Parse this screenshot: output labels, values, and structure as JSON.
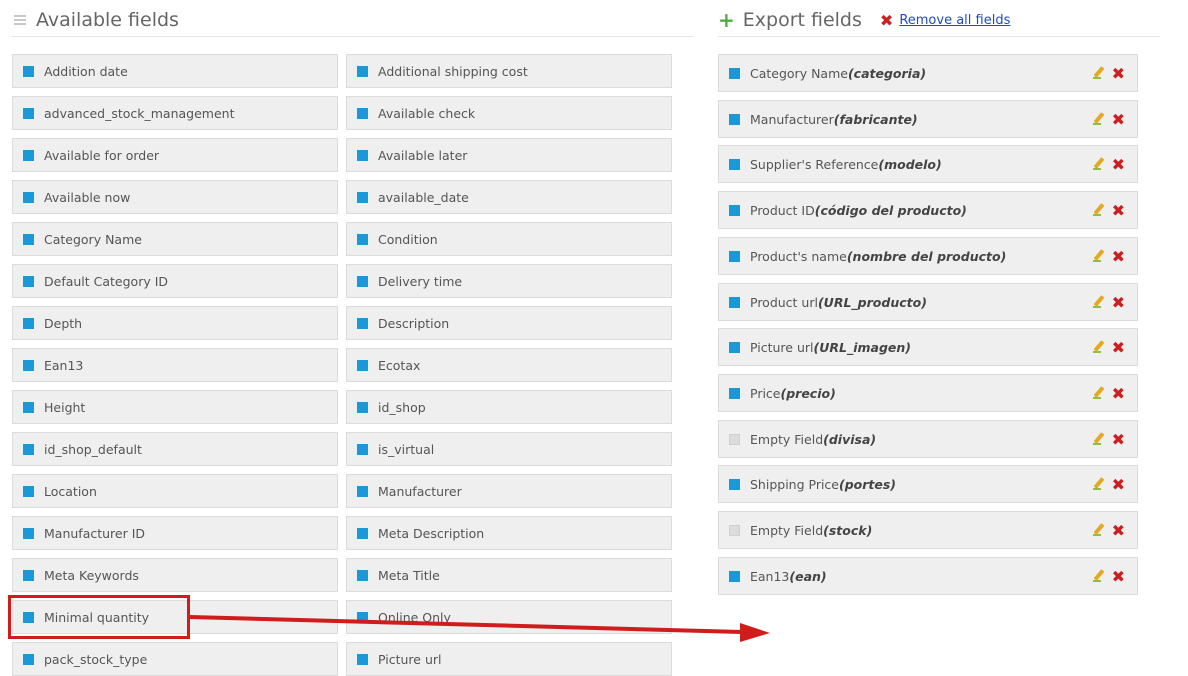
{
  "available": {
    "title": "Available fields",
    "fields": [
      {
        "label": "Addition date",
        "col": 0
      },
      {
        "label": "Additional shipping cost",
        "col": 1
      },
      {
        "label": "advanced_stock_management",
        "col": 0
      },
      {
        "label": "Available check",
        "col": 1
      },
      {
        "label": "Available for order",
        "col": 0
      },
      {
        "label": "Available later",
        "col": 1
      },
      {
        "label": "Available now",
        "col": 0
      },
      {
        "label": "available_date",
        "col": 1
      },
      {
        "label": "Category Name",
        "col": 0
      },
      {
        "label": "Condition",
        "col": 1
      },
      {
        "label": "Default Category ID",
        "col": 0
      },
      {
        "label": "Delivery time",
        "col": 1
      },
      {
        "label": "Depth",
        "col": 0
      },
      {
        "label": "Description",
        "col": 1
      },
      {
        "label": "Ean13",
        "col": 0
      },
      {
        "label": "Ecotax",
        "col": 1
      },
      {
        "label": "Height",
        "col": 0
      },
      {
        "label": "id_shop",
        "col": 1
      },
      {
        "label": "id_shop_default",
        "col": 0
      },
      {
        "label": "is_virtual",
        "col": 1
      },
      {
        "label": "Location",
        "col": 0
      },
      {
        "label": "Manufacturer",
        "col": 1
      },
      {
        "label": "Manufacturer ID",
        "col": 0
      },
      {
        "label": "Meta Description",
        "col": 1
      },
      {
        "label": "Meta Keywords",
        "col": 0
      },
      {
        "label": "Meta Title",
        "col": 1
      },
      {
        "label": "Minimal quantity",
        "col": 0
      },
      {
        "label": "Online Only",
        "col": 1
      },
      {
        "label": "pack_stock_type",
        "col": 0
      },
      {
        "label": "Picture url",
        "col": 1
      }
    ]
  },
  "export": {
    "title": "Export fields",
    "remove_all_label": "Remove all fields",
    "fields": [
      {
        "name": "Category Name",
        "alias": "(categoria)",
        "enabled": true
      },
      {
        "name": "Manufacturer",
        "alias": "(fabricante)",
        "enabled": true
      },
      {
        "name": "Supplier's Reference",
        "alias": "(modelo)",
        "enabled": true
      },
      {
        "name": "Product ID",
        "alias": "(código del producto)",
        "enabled": true
      },
      {
        "name": "Product's name",
        "alias": "(nombre del producto)",
        "enabled": true
      },
      {
        "name": "Product url",
        "alias": "(URL_producto)",
        "enabled": true
      },
      {
        "name": "Picture url",
        "alias": "(URL_imagen)",
        "enabled": true
      },
      {
        "name": "Price",
        "alias": "(precio)",
        "enabled": true
      },
      {
        "name": "Empty Field",
        "alias": "(divisa)",
        "enabled": false
      },
      {
        "name": "Shipping Price",
        "alias": "(portes)",
        "enabled": true
      },
      {
        "name": "Empty Field",
        "alias": "(stock)",
        "enabled": false
      },
      {
        "name": "Ean13",
        "alias": "(ean)",
        "enabled": true
      }
    ]
  },
  "colors": {
    "accent_blue": "#1a99d8",
    "delete_red": "#cc1f1f",
    "annotation_red": "#d01c1c",
    "add_green": "#4caf3d"
  },
  "icons": {
    "available_heading": "drag-grip-icon",
    "export_heading": "plus-icon",
    "remove_all": "close-icon",
    "edit": "pencil-icon",
    "delete": "close-icon"
  }
}
